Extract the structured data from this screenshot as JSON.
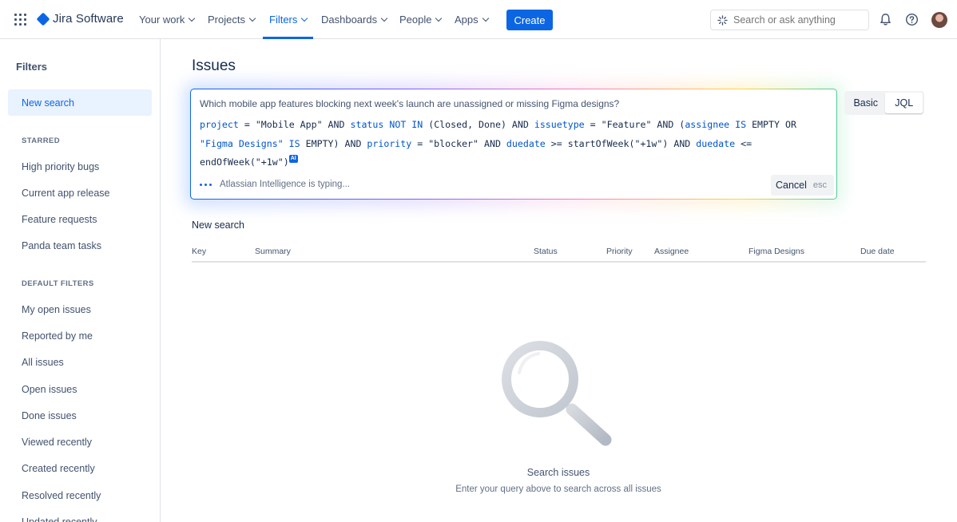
{
  "app": {
    "name": "Jira Software"
  },
  "nav": {
    "your_work": "Your work",
    "projects": "Projects",
    "filters": "Filters",
    "dashboards": "Dashboards",
    "people": "People",
    "apps": "Apps",
    "create": "Create",
    "search_placeholder": "Search or ask anything"
  },
  "sidebar": {
    "title": "Filters",
    "new_search": "New search",
    "starred_heading": "STARRED",
    "starred": [
      "High priority bugs",
      "Current app release",
      "Feature requests",
      "Panda team tasks"
    ],
    "default_heading": "DEFAULT FILTERS",
    "defaults": [
      "My open issues",
      "Reported by me",
      "All issues",
      "Open issues",
      "Done issues",
      "Viewed recently",
      "Created recently",
      "Resolved recently",
      "Updated recently"
    ]
  },
  "main": {
    "title": "Issues",
    "nl_query": "Which mobile app features blocking next week's launch are unassigned or missing Figma designs?",
    "jql": {
      "t1": "project",
      "t2": " = \"Mobile App\" AND ",
      "t3": "status",
      "t4": " NOT IN ",
      "t5": "(Closed, Done) AND ",
      "t6": "issuetype",
      "t7": " = \"Feature\" AND (",
      "t8": "assignee",
      "t9": " IS ",
      "t10": "EMPTY OR",
      "t11": "\"Figma Designs\"",
      "t12": " IS ",
      "t13": "EMPTY) AND ",
      "t14": "priority",
      "t15": " = \"blocker\" AND ",
      "t16": "duedate",
      "t17": " >= startOfWeek(\"+1w\") AND ",
      "t18": "duedate",
      "t19": " <=",
      "t20": "endOfWeek(\"+1w\")",
      "ai_badge": "AI"
    },
    "typing_status": "Atlassian Intelligence is typing...",
    "cancel": "Cancel",
    "cancel_shortcut": "esc",
    "toggle": {
      "basic": "Basic",
      "jql": "JQL",
      "selected": "JQL"
    },
    "section_title": "New search",
    "columns": [
      "Key",
      "Summary",
      "Status",
      "Priority",
      "Assignee",
      "Figma Designs",
      "Due date"
    ],
    "empty_title": "Search issues",
    "empty_subtitle": "Enter your query above to search across all issues"
  },
  "icons": {
    "app_switcher": "grid-icon",
    "logo": "jira-logo-icon",
    "search": "ai-sparkle-icon",
    "notifications": "bell-icon",
    "help": "help-icon",
    "empty": "magnifier-icon"
  },
  "colors": {
    "accent": "#0c66e4",
    "text": "#172b4d",
    "subtle": "#626f86"
  }
}
